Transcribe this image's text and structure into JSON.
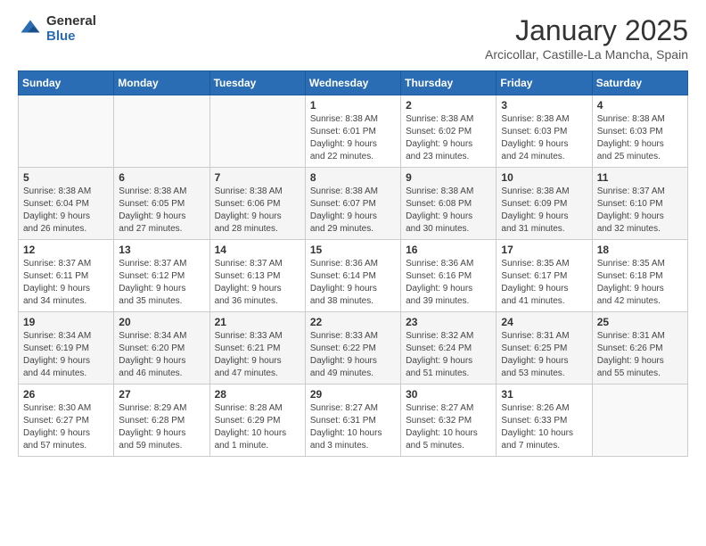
{
  "header": {
    "logo_general": "General",
    "logo_blue": "Blue",
    "month_title": "January 2025",
    "location": "Arcicollar, Castille-La Mancha, Spain"
  },
  "weekdays": [
    "Sunday",
    "Monday",
    "Tuesday",
    "Wednesday",
    "Thursday",
    "Friday",
    "Saturday"
  ],
  "weeks": [
    [
      {
        "day": "",
        "info": ""
      },
      {
        "day": "",
        "info": ""
      },
      {
        "day": "",
        "info": ""
      },
      {
        "day": "1",
        "info": "Sunrise: 8:38 AM\nSunset: 6:01 PM\nDaylight: 9 hours\nand 22 minutes."
      },
      {
        "day": "2",
        "info": "Sunrise: 8:38 AM\nSunset: 6:02 PM\nDaylight: 9 hours\nand 23 minutes."
      },
      {
        "day": "3",
        "info": "Sunrise: 8:38 AM\nSunset: 6:03 PM\nDaylight: 9 hours\nand 24 minutes."
      },
      {
        "day": "4",
        "info": "Sunrise: 8:38 AM\nSunset: 6:03 PM\nDaylight: 9 hours\nand 25 minutes."
      }
    ],
    [
      {
        "day": "5",
        "info": "Sunrise: 8:38 AM\nSunset: 6:04 PM\nDaylight: 9 hours\nand 26 minutes."
      },
      {
        "day": "6",
        "info": "Sunrise: 8:38 AM\nSunset: 6:05 PM\nDaylight: 9 hours\nand 27 minutes."
      },
      {
        "day": "7",
        "info": "Sunrise: 8:38 AM\nSunset: 6:06 PM\nDaylight: 9 hours\nand 28 minutes."
      },
      {
        "day": "8",
        "info": "Sunrise: 8:38 AM\nSunset: 6:07 PM\nDaylight: 9 hours\nand 29 minutes."
      },
      {
        "day": "9",
        "info": "Sunrise: 8:38 AM\nSunset: 6:08 PM\nDaylight: 9 hours\nand 30 minutes."
      },
      {
        "day": "10",
        "info": "Sunrise: 8:38 AM\nSunset: 6:09 PM\nDaylight: 9 hours\nand 31 minutes."
      },
      {
        "day": "11",
        "info": "Sunrise: 8:37 AM\nSunset: 6:10 PM\nDaylight: 9 hours\nand 32 minutes."
      }
    ],
    [
      {
        "day": "12",
        "info": "Sunrise: 8:37 AM\nSunset: 6:11 PM\nDaylight: 9 hours\nand 34 minutes."
      },
      {
        "day": "13",
        "info": "Sunrise: 8:37 AM\nSunset: 6:12 PM\nDaylight: 9 hours\nand 35 minutes."
      },
      {
        "day": "14",
        "info": "Sunrise: 8:37 AM\nSunset: 6:13 PM\nDaylight: 9 hours\nand 36 minutes."
      },
      {
        "day": "15",
        "info": "Sunrise: 8:36 AM\nSunset: 6:14 PM\nDaylight: 9 hours\nand 38 minutes."
      },
      {
        "day": "16",
        "info": "Sunrise: 8:36 AM\nSunset: 6:16 PM\nDaylight: 9 hours\nand 39 minutes."
      },
      {
        "day": "17",
        "info": "Sunrise: 8:35 AM\nSunset: 6:17 PM\nDaylight: 9 hours\nand 41 minutes."
      },
      {
        "day": "18",
        "info": "Sunrise: 8:35 AM\nSunset: 6:18 PM\nDaylight: 9 hours\nand 42 minutes."
      }
    ],
    [
      {
        "day": "19",
        "info": "Sunrise: 8:34 AM\nSunset: 6:19 PM\nDaylight: 9 hours\nand 44 minutes."
      },
      {
        "day": "20",
        "info": "Sunrise: 8:34 AM\nSunset: 6:20 PM\nDaylight: 9 hours\nand 46 minutes."
      },
      {
        "day": "21",
        "info": "Sunrise: 8:33 AM\nSunset: 6:21 PM\nDaylight: 9 hours\nand 47 minutes."
      },
      {
        "day": "22",
        "info": "Sunrise: 8:33 AM\nSunset: 6:22 PM\nDaylight: 9 hours\nand 49 minutes."
      },
      {
        "day": "23",
        "info": "Sunrise: 8:32 AM\nSunset: 6:24 PM\nDaylight: 9 hours\nand 51 minutes."
      },
      {
        "day": "24",
        "info": "Sunrise: 8:31 AM\nSunset: 6:25 PM\nDaylight: 9 hours\nand 53 minutes."
      },
      {
        "day": "25",
        "info": "Sunrise: 8:31 AM\nSunset: 6:26 PM\nDaylight: 9 hours\nand 55 minutes."
      }
    ],
    [
      {
        "day": "26",
        "info": "Sunrise: 8:30 AM\nSunset: 6:27 PM\nDaylight: 9 hours\nand 57 minutes."
      },
      {
        "day": "27",
        "info": "Sunrise: 8:29 AM\nSunset: 6:28 PM\nDaylight: 9 hours\nand 59 minutes."
      },
      {
        "day": "28",
        "info": "Sunrise: 8:28 AM\nSunset: 6:29 PM\nDaylight: 10 hours\nand 1 minute."
      },
      {
        "day": "29",
        "info": "Sunrise: 8:27 AM\nSunset: 6:31 PM\nDaylight: 10 hours\nand 3 minutes."
      },
      {
        "day": "30",
        "info": "Sunrise: 8:27 AM\nSunset: 6:32 PM\nDaylight: 10 hours\nand 5 minutes."
      },
      {
        "day": "31",
        "info": "Sunrise: 8:26 AM\nSunset: 6:33 PM\nDaylight: 10 hours\nand 7 minutes."
      },
      {
        "day": "",
        "info": ""
      }
    ]
  ]
}
